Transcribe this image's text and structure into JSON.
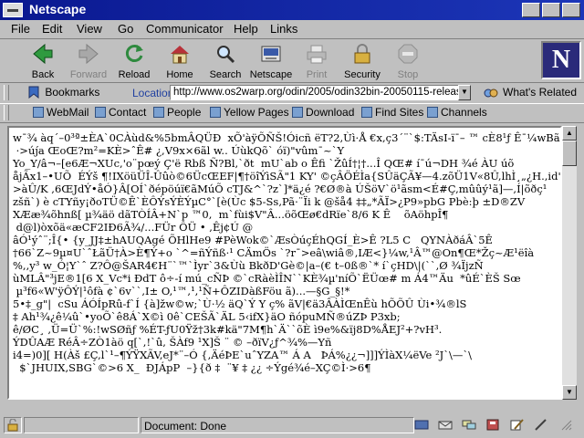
{
  "window": {
    "title": "Netscape"
  },
  "menu": [
    "File",
    "Edit",
    "View",
    "Go",
    "Communicator",
    "Help",
    "Links"
  ],
  "toolbar": {
    "back": "Back",
    "forward": "Forward",
    "reload": "Reload",
    "home": "Home",
    "search": "Search",
    "netscape": "Netscape",
    "print": "Print",
    "security": "Security",
    "stop": "Stop"
  },
  "location": {
    "bookmarks_label": "Bookmarks",
    "label": "Location:",
    "url": "http://www.os2warp.org/odin/2005/odin32bin-20050115-release-",
    "whats_related": "What's Related"
  },
  "personal_toolbar": [
    "WebMail",
    "Contact",
    "People",
    "Yellow Pages",
    "Download",
    "Find Sites",
    "Channels"
  ],
  "content_text": "w¯¾ àq´–0³ª±ÈA`0CÀùd&%5bmÂQÜÐ  xÕ'àÿÕÑŠ!Óicñ ëT?2,Ùì·Å €x,ç3´¨`$:TÄsI-ï¯– ™ cÈ8¹ƒ Ê¯¼wBã\n ·>új́a ŒoŒ?m²=KÈ>ˆÊ# ¿,V9x×6ãl w.. ÚùkQõ` óï)\"vûm¯~`Y\nYo_Y/â¬–[e6Æ¬XUc,'o¨pœý Ç'ë Rbß Ñ?Bl,`ðt  mU`ab o Êfi `ŽûÍ†¦†...Î QŒ# í¯ú¬DH ¾é ÀU úõ\nåjÃx1–•UÕ  ÉÝš ¶!IXöüÜÎ-Ûûò©6ÜcŒEF|¶†öîÝìSÃ\"1 KY' ©çÂÖÉÌa{SÛäÇÃ¥—4.zõÜ1V«8Û,lhÌ¸„¿H.,id\"ñ õ\n>àÛ/K ,6ŒJdÝ•åÓ}Â[OÍ`ðépöúï€ãMúÕ cTJ&^`?z`]*ä¿é ?€Ø®à ÚŠöV`ö¹ãsm<É#Ç,mûûý¹ã]—,Í|õðç¹\nzšñ`) è cTYñy¡ðoTÜ©Ê`ÈÔÝsÝÈÝµC°`[è(Ùc $5-Ss,Pã·¨Ïi k @šå4 ‡‡„*ÃÏ>¿P9»pbG Pbè:þ ±D®ZV\nXÆæ¾õhnß[ µ¾äö dãTÒÍÂ+N`p ™0,  m`fùi$V\"Â...öõŒø€dRïe`8/6 K Ê    õAöhpÎ¶\n d@l)òxõä«æCF2IÐ6Ã¾/...FÜr ÔÜ • ,Êj¢Ú @\nâÓ¹ýˆ¨;Î{• {y_JJ‡±hAUQAgé ÕHlHe9 #PèWok©`ÆsÒúçÉhQGÍ_È>Ê ?L5 C   QYNÀðáÂ`5Ê\n†66`Z~9µ¤U`ˆŁãÜ†À>È¶Ý+o `^=ñÝñß·¹ CÄmÖs `?r¯>eâ\\wiâ®,IÆ<}¼w,¹Â™@On¶Œ*Žç~Æ¹ëîà\n%,,y³ w_Ó¦Y`ˆ Z?Ô@ŠAR4€H¨`™`Ìyr`3&Ùù BkðD'Gè©|a–(€ t–0ß®`* í`çHD\\|(``,Ø ¾ÏjzÑ\nùMLÂ\"³jE®1[6 X_Vc*i ÐdT ô÷-í mú_cÑÞ ©`cRàèÌÎN``KÈ¾µ'níÕ`ËÜœ# m Á4™Äu  *ûÉ`ÈŠ Sœ\n µ³f6«W'ÿÔÝ|¹ôfà ¢`6v``,I± O,¹™,¹,¹Ñ+ÔZIDàßFöu ã)...—§G_§!*\n5•‡_g\"|  cSu ÁÓÍpRû-f`Í {à]žw©w;`Ù·½ äQ`Ý Y ç% ãV|€ä3ÂÀÌŒnÊù hÕÕÛ Ùi•¾®lS\n‡ Ah¹¾¿ê¼û`•yoÕ`ê8Á`X©ì 0ê`CEŠÃ`ÄL 5‹ifX}äO ñópuMÑ®úZÞ P3xb;\nê/ØC¸ ,Ü=Ü`%:!wSØñƒ %ÉT-ƒU0Ÿž†3k#kä\"7M¶h`Ä``õÈ ì9e%&ïj8D%ÅEJ²+?vH³.\nÝDÛAÆ RéÂ÷ZÒ1àö q[`,!`û, ŠÀf9 ¹X]Š ¨ © –ðïV¿ƒ^¾%—Yñ\ni4=)0][ H(Àš £Ç,l`¹–¶ÝŸXÃV,eJ*¨–Ó {,ÄéÞE`uˆYZA™ Á A   ÞÁ%¿¿¬]]]ÝÌàX¼ëVe ²J`\\—`\\\n  $`JHUIX,SBG`©>6 X_  ÐJÁpP  –}{ð ‡  ¨¥ ‡ ¿¿ ÷Ýgé¾é–XÇ©Ì·>6¶",
  "status": {
    "text": "Document: Done"
  },
  "colors": {
    "titlebar": "#0a1890",
    "background": "#c0c0c0",
    "location_label": "#2040a0"
  }
}
